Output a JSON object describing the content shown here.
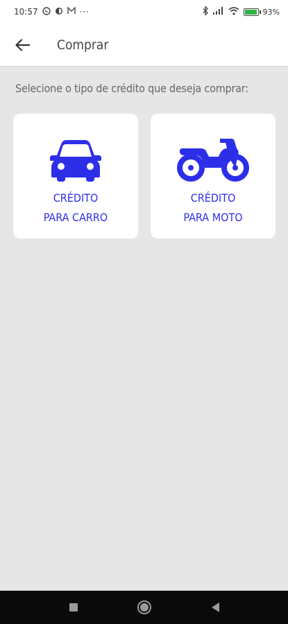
{
  "status_bar": {
    "time": "10:57",
    "battery_percent": "93",
    "left_icons": [
      "whatsapp-icon",
      "sync-icon",
      "mail-icon",
      "more-icon"
    ],
    "right_icons": [
      "bluetooth-icon",
      "signal-icon",
      "wifi-icon",
      "battery-icon"
    ]
  },
  "app_bar": {
    "back_icon": "arrow-left-icon",
    "title": "Comprar"
  },
  "main": {
    "prompt": "Selecione o tipo de crédito que deseja comprar:",
    "cards": [
      {
        "icon": "car-icon",
        "line1": "CRÉDITO",
        "line2": "PARA CARRO"
      },
      {
        "icon": "motorcycle-icon",
        "line1": "CRÉDITO",
        "line2": "PARA MOTO"
      }
    ]
  },
  "nav_bar": {
    "buttons": [
      "recent-apps",
      "home",
      "back"
    ]
  },
  "colors": {
    "accent": "#2d2fe8",
    "background": "#e6e6e6",
    "card": "#ffffff"
  }
}
